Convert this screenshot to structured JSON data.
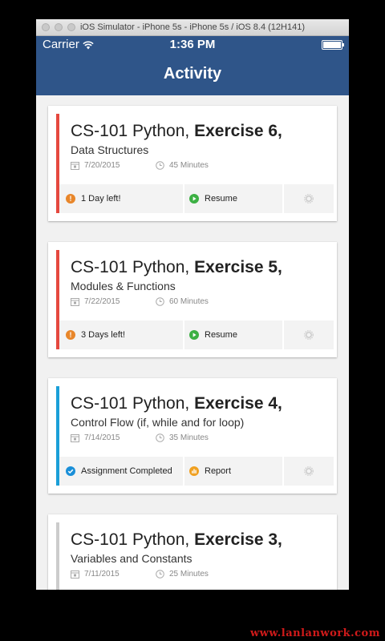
{
  "simulator": {
    "title": "iOS Simulator - iPhone 5s - iPhone 5s / iOS 8.4 (12H141)"
  },
  "status_bar": {
    "carrier": "Carrier",
    "time": "1:36 PM",
    "battery_level_percent": 100
  },
  "nav": {
    "title": "Activity"
  },
  "colors": {
    "nav": "#2f5589",
    "urgent": "#e5483f",
    "completed": "#1a9fd8",
    "inactive": "#cccccc",
    "warning_icon": "#e8862a",
    "resume_icon": "#3cb043",
    "completed_icon": "#1a8fd8",
    "report_icon": "#f0a020"
  },
  "cards": [
    {
      "course": "CS-101 Python,",
      "exercise": "Exercise 6,",
      "topic": "Data Structures",
      "date": "7/20/2015",
      "duration": "45 Minutes",
      "status": "1 Day left!",
      "action": "Resume"
    },
    {
      "course": "CS-101 Python,",
      "exercise": "Exercise 5,",
      "topic": "Modules & Functions",
      "date": "7/22/2015",
      "duration": "60 Minutes",
      "status": "3 Days left!",
      "action": "Resume"
    },
    {
      "course": "CS-101 Python,",
      "exercise": "Exercise 4,",
      "topic": "Control Flow (if, while and for loop)",
      "date": "7/14/2015",
      "duration": "35 Minutes",
      "status": "Assignment Completed",
      "action": "Report"
    },
    {
      "course": "CS-101 Python,",
      "exercise": "Exercise 3,",
      "topic": "Variables and Constants",
      "date": "7/11/2015",
      "duration": "25 Minutes"
    }
  ],
  "watermark": "www.lanlanwork.com"
}
